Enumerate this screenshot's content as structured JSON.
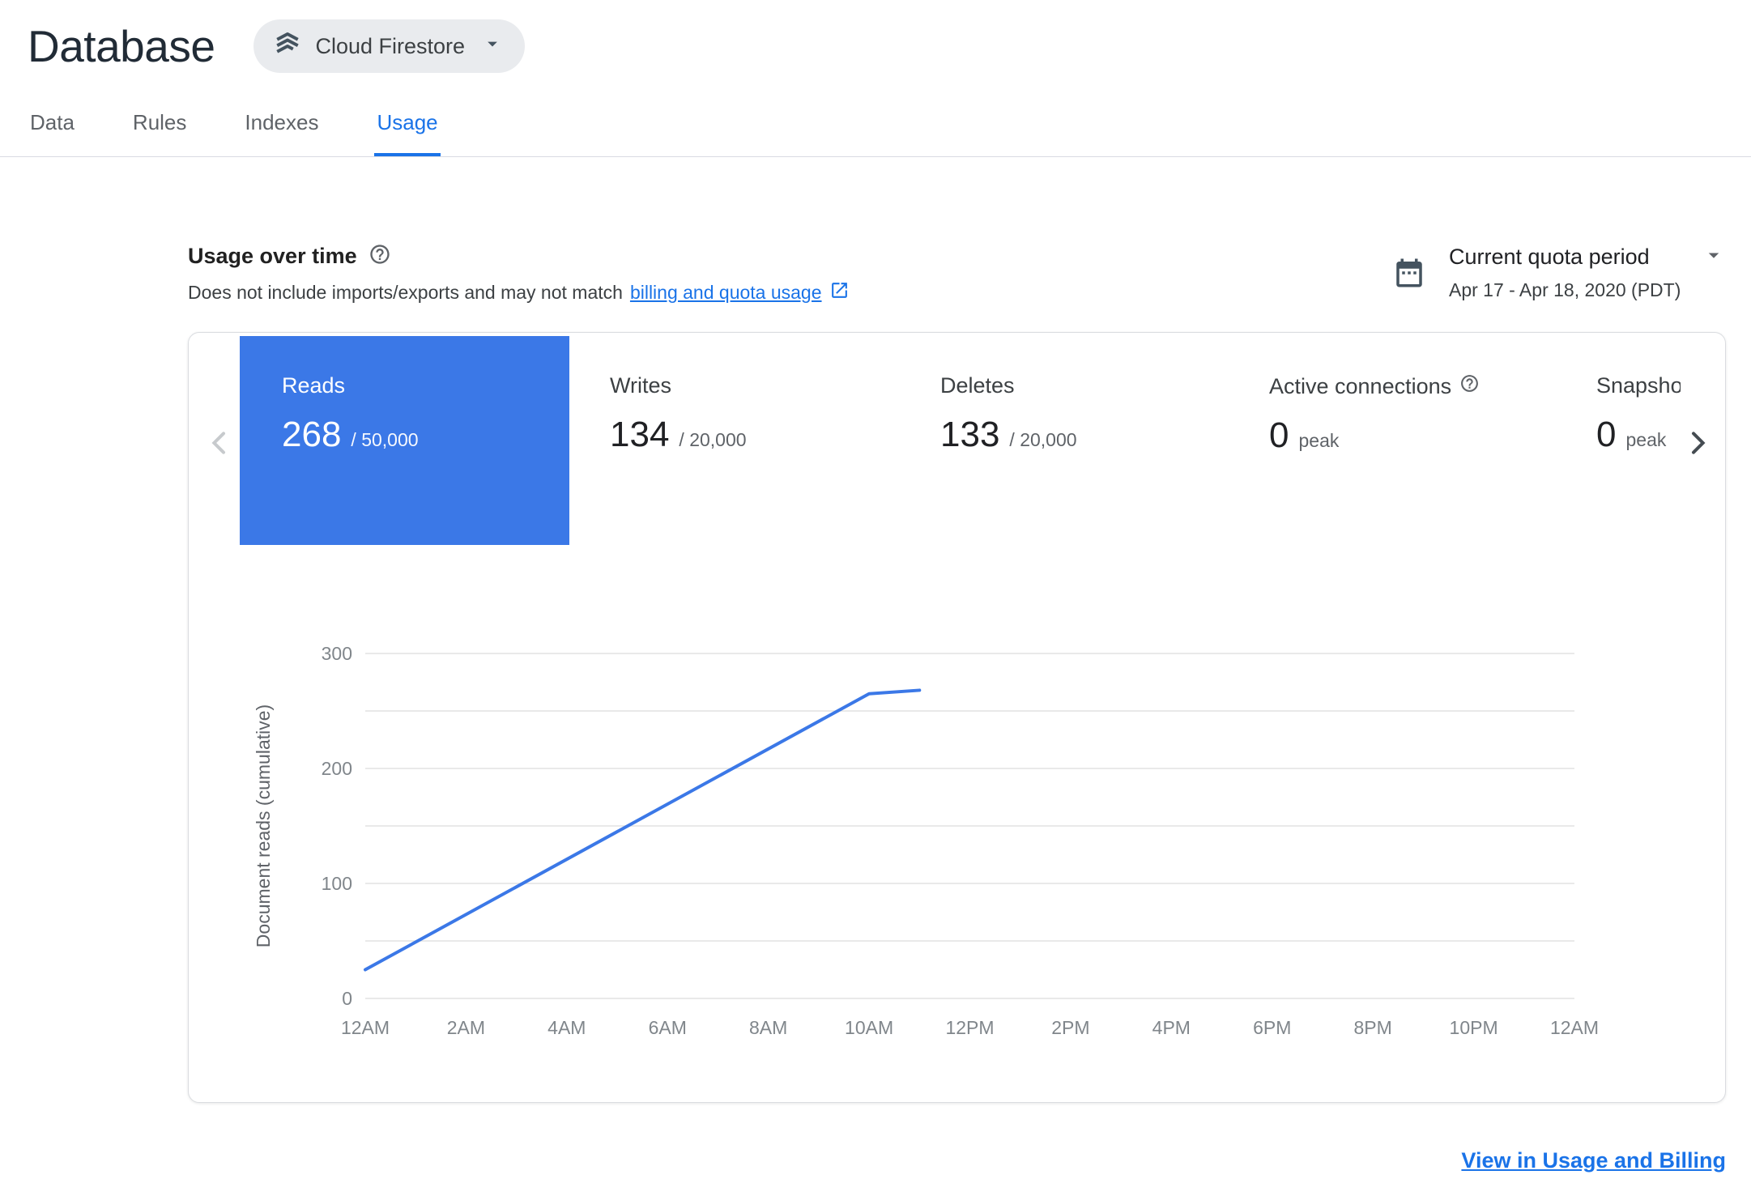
{
  "colors": {
    "link_blue": "#1a73e8",
    "accent_blue": "#3b78e7"
  },
  "header": {
    "title": "Database",
    "selector_label": "Cloud Firestore"
  },
  "tabs": [
    {
      "label": "Data",
      "active": false
    },
    {
      "label": "Rules",
      "active": false
    },
    {
      "label": "Indexes",
      "active": false
    },
    {
      "label": "Usage",
      "active": true
    }
  ],
  "section": {
    "title": "Usage over time",
    "subtitle_prefix": "Does not include imports/exports and may not match",
    "subtitle_link_label": "billing and quota usage",
    "period_label": "Current quota period",
    "period_range": "Apr 17 - Apr 18, 2020 (PDT)"
  },
  "metrics": [
    {
      "label": "Reads",
      "value": "268",
      "suffix": "/ 50,000",
      "active": true
    },
    {
      "label": "Writes",
      "value": "134",
      "suffix": "/ 20,000",
      "active": false
    },
    {
      "label": "Deletes",
      "value": "133",
      "suffix": "/ 20,000",
      "active": false
    },
    {
      "label": "Active connections",
      "value": "0",
      "suffix": "peak",
      "active": false
    },
    {
      "label": "Snapshot",
      "value": "0",
      "suffix": "peak",
      "active": false
    }
  ],
  "chart_data": {
    "type": "line",
    "title": "",
    "xlabel": "",
    "ylabel": "Document reads (cumulative)",
    "xlim": [
      0,
      24
    ],
    "ylim": [
      0,
      300
    ],
    "grid": "horizontal",
    "grid_step": 50,
    "legend": "none",
    "y_ticks": [
      0,
      100,
      200,
      300
    ],
    "x_ticks": [
      {
        "hour": 0,
        "label": "12AM"
      },
      {
        "hour": 2,
        "label": "2AM"
      },
      {
        "hour": 4,
        "label": "4AM"
      },
      {
        "hour": 6,
        "label": "6AM"
      },
      {
        "hour": 8,
        "label": "8AM"
      },
      {
        "hour": 10,
        "label": "10AM"
      },
      {
        "hour": 12,
        "label": "12PM"
      },
      {
        "hour": 14,
        "label": "2PM"
      },
      {
        "hour": 16,
        "label": "4PM"
      },
      {
        "hour": 18,
        "label": "6PM"
      },
      {
        "hour": 20,
        "label": "8PM"
      },
      {
        "hour": 22,
        "label": "10PM"
      },
      {
        "hour": 24,
        "label": "12AM"
      }
    ],
    "series": [
      {
        "name": "Document reads (cumulative)",
        "color": "#3b78e7",
        "points": [
          {
            "hour": 0,
            "value": 25
          },
          {
            "hour": 10,
            "value": 265
          },
          {
            "hour": 11,
            "value": 268
          }
        ]
      }
    ]
  },
  "footer": {
    "link_label": "View in Usage and Billing"
  }
}
